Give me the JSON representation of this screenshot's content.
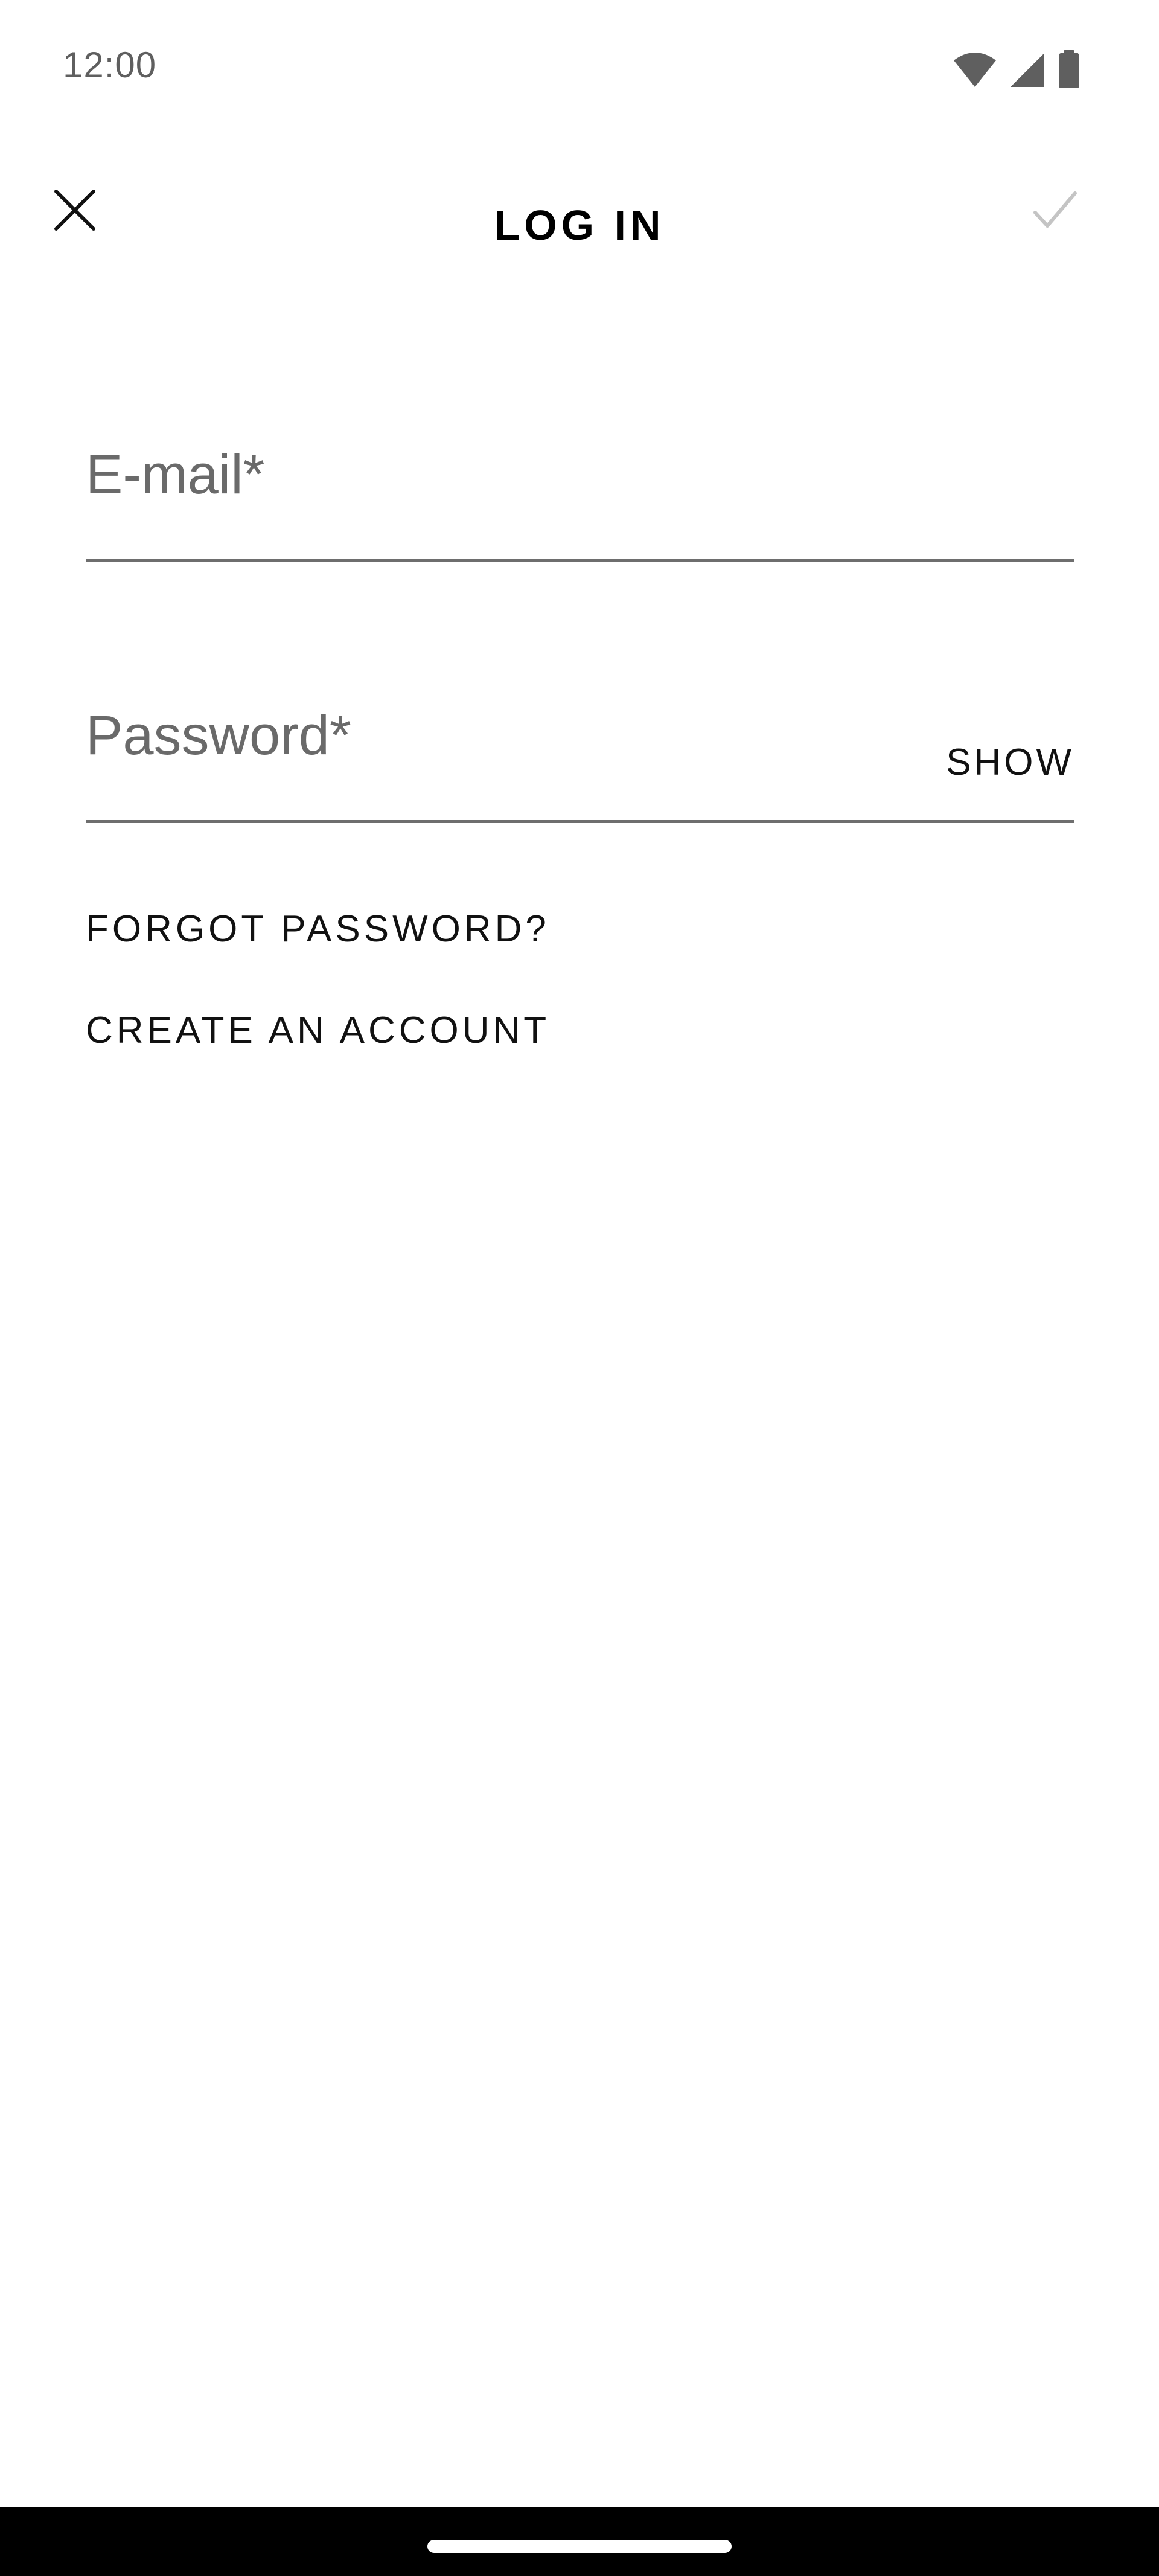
{
  "status_bar": {
    "time": "12:00",
    "icons": [
      "wifi-icon",
      "cellular-signal-icon",
      "battery-icon"
    ]
  },
  "header": {
    "title": "LOG IN",
    "close_icon": "close-icon",
    "confirm_icon": "checkmark-icon"
  },
  "form": {
    "email": {
      "label": "E-mail*",
      "value": ""
    },
    "password": {
      "label": "Password*",
      "value": "",
      "show_toggle": "SHOW"
    }
  },
  "links": {
    "forgot_password": "FORGOT PASSWORD?",
    "create_account": "CREATE AN ACCOUNT"
  },
  "colors": {
    "background": "#ffffff",
    "text": "#111111",
    "label": "#6a6a6a",
    "underline": "#6e6e6e",
    "confirm_disabled": "#c4c4c4",
    "nav_bar": "#000000"
  }
}
